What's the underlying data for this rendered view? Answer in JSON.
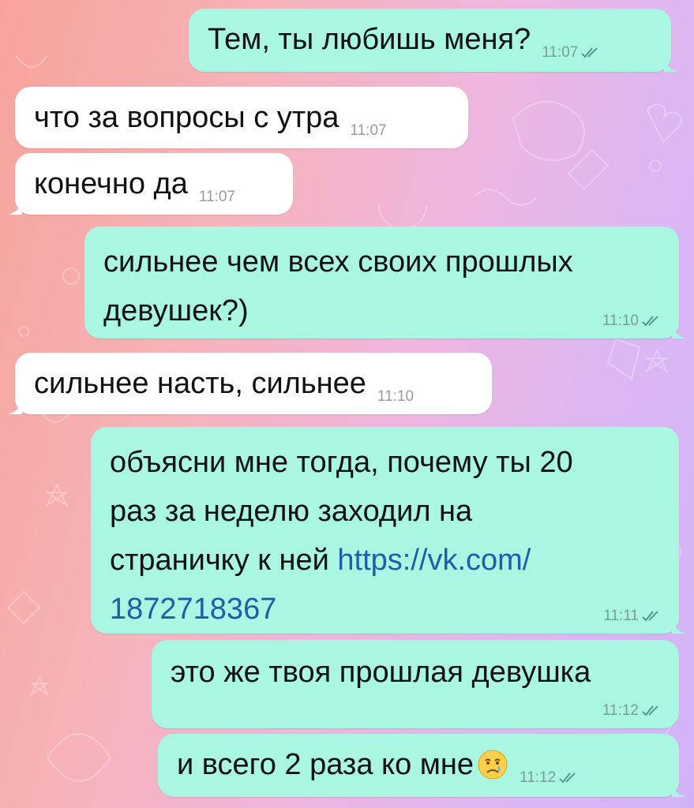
{
  "colors": {
    "outgoing_bubble": "#a9f7e2",
    "incoming_bubble": "#ffffff",
    "link": "#1d5ea8",
    "meta_out": "#7b9c93",
    "meta_in": "#9a9a9a"
  },
  "messages": [
    {
      "direction": "out",
      "text": "Тем, ты любишь меня?",
      "time": "11:07",
      "status": "read-double-check-icon"
    },
    {
      "direction": "in",
      "text": "что за вопросы с утра",
      "time": "11:07"
    },
    {
      "direction": "in",
      "text": "конечно да",
      "time": "11:07"
    },
    {
      "direction": "out",
      "text": "сильнее чем всех своих прошлых\nдевушек?)",
      "time": "11:10",
      "status": "read-double-check-icon"
    },
    {
      "direction": "in",
      "text": "сильнее насть, сильнее",
      "time": "11:10"
    },
    {
      "direction": "out",
      "text": "объясни мне тогда, почему ты 20\nраз за неделю заходил на\nстраничку к ней ",
      "link": "https://vk.com/\n1872718367",
      "time": "11:11",
      "status": "read-double-check-icon"
    },
    {
      "direction": "out",
      "text": "это же твоя прошлая девушка",
      "time": "11:12",
      "status": "read-double-check-icon"
    },
    {
      "direction": "out",
      "text": "и всего 2 раза ко мне",
      "emoji": "crying-face-emoji",
      "time": "11:12",
      "status": "read-double-check-icon"
    }
  ]
}
